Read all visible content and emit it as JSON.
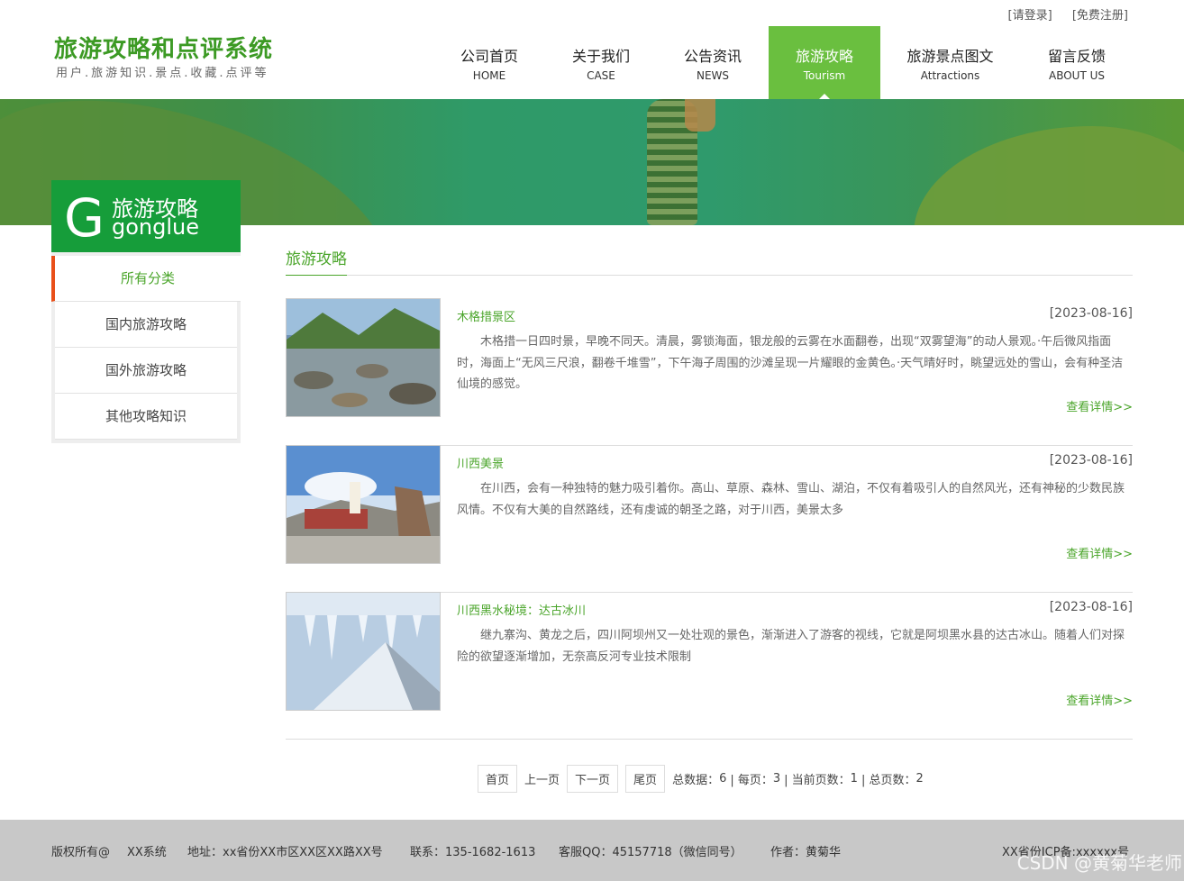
{
  "header": {
    "login": "[请登录]",
    "register": "[免费注册]",
    "title": "旅游攻略和点评系统",
    "subtitle": "用户.旅游知识.景点.收藏.点评等"
  },
  "nav": [
    {
      "cn": "公司首页",
      "en": "HOME"
    },
    {
      "cn": "关于我们",
      "en": "CASE"
    },
    {
      "cn": "公告资讯",
      "en": "NEWS"
    },
    {
      "cn": "旅游攻略",
      "en": "Tourism"
    },
    {
      "cn": "旅游景点图文",
      "en": "Attractions"
    },
    {
      "cn": "留言反馈",
      "en": "ABOUT US"
    }
  ],
  "sidebar": {
    "letter": "G",
    "title_cn": "旅游攻略",
    "title_en": "gonglue",
    "items": [
      "所有分类",
      "国内旅游攻略",
      "国外旅游攻略",
      "其他攻略知识"
    ]
  },
  "main": {
    "title": "旅游攻略",
    "articles": [
      {
        "title": "木格措景区",
        "date": "[2023-08-16]",
        "desc": "木格措一日四时景，早晚不同天。清晨，雾锁海面，银龙般的云雾在水面翻卷，出现“双雾望海”的动人景观。·午后微风指面时，海面上“无风三尺浪，翻卷千堆雪”，下午海子周围的沙滩呈现一片耀眼的金黄色。·天气晴好时，眺望远处的雪山，会有种圣洁仙境的感觉。",
        "more": "查看详情>>"
      },
      {
        "title": "川西美景",
        "date": "[2023-08-16]",
        "desc": "在川西，会有一种独特的魅力吸引着你。高山、草原、森林、雪山、湖泊，不仅有着吸引人的自然风光，还有神秘的少数民族风情。不仅有大美的自然路线，还有虔诚的朝圣之路，对于川西，美景太多",
        "more": "查看详情>>"
      },
      {
        "title": "川西黑水秘境：达古冰川",
        "date": "[2023-08-16]",
        "desc": "继九寨沟、黄龙之后，四川阿坝州又一处壮观的景色，渐渐进入了游客的视线，它就是阿坝黑水县的达古冰山。随着人们对探险的欲望逐渐增加，无奈高反河专业技术限制",
        "more": "查看详情>>"
      }
    ]
  },
  "pager": {
    "first": "首页",
    "prev": "上一页",
    "next": "下一页",
    "last": "尾页",
    "total_label": "总数据：",
    "total": "6",
    "per_label": "| 每页：",
    "per": "3",
    "cur_label": "| 当前页数：",
    "cur": "1",
    "pages_label": "| 总页数：",
    "pages": "2"
  },
  "footer": {
    "copyright": "版权所有@",
    "system": "XX系统",
    "address": "地址：xx省份XX市区XX区XX路XX号",
    "contact": "联系：135-1682-1613",
    "qq": "客服QQ：45157718（微信同号）",
    "author": "作者：黄菊华",
    "icp": "XX省份ICP备:xxxxxx号",
    "watermark": "CSDN @黄菊华老师"
  },
  "colors": {
    "accent": "#6abf3f",
    "side_head": "#169d3a",
    "link": "#4aa52a",
    "active_marker": "#e94f19"
  }
}
